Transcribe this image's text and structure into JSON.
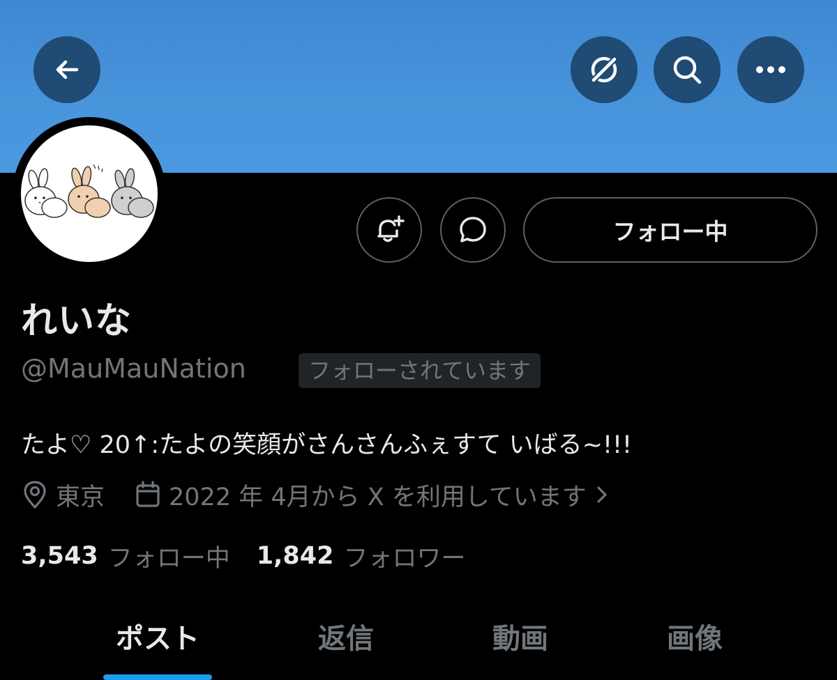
{
  "header": {
    "back_icon": "arrow-left-icon",
    "translate_icon": "translate-icon",
    "search_icon": "search-icon",
    "more_icon": "more-icon"
  },
  "profile": {
    "display_name": "れいな",
    "handle": "@MauMauNation",
    "follows_you_badge": "フォローされています",
    "bio": "たよ♡ 20↑:たよの笑顔がさんさんふぇすて いばる~!!!",
    "location": "東京",
    "joined": "2022 年 4月から X を利用しています",
    "following_count": "3,543",
    "following_label": "フォロー中",
    "followers_count": "1,842",
    "followers_label": "フォロワー"
  },
  "actions": {
    "follow_button_label": "フォロー中"
  },
  "tabs": [
    {
      "label": "ポスト",
      "active": true
    },
    {
      "label": "返信",
      "active": false
    },
    {
      "label": "動画",
      "active": false
    },
    {
      "label": "画像",
      "active": false
    }
  ],
  "colors": {
    "banner": "#4895dc",
    "accent": "#1d9bf0",
    "muted": "#71767b",
    "text": "#e7e9ea"
  }
}
